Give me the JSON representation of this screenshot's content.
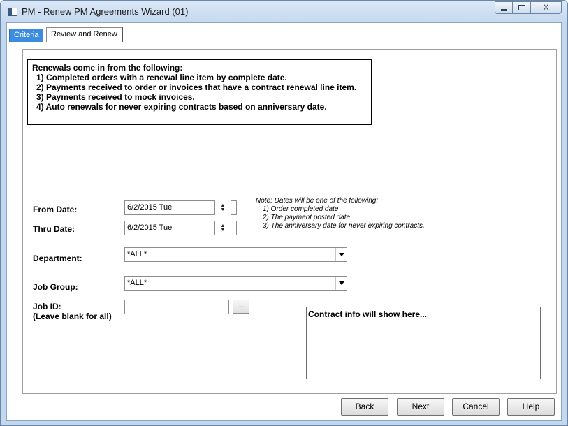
{
  "window": {
    "title": "PM - Renew PM Agreements Wizard (01)",
    "controls": {
      "minimize": "minimize-icon",
      "maximize": "maximize-icon",
      "close": "close-icon",
      "close_glyph": "X"
    }
  },
  "tabs": [
    {
      "label": "Criteria",
      "active": true
    },
    {
      "label": "Review and Renew",
      "active": false
    }
  ],
  "info": {
    "heading": "Renewals come in from the following:",
    "items": [
      "1) Completed orders with a renewal line item by complete date.",
      "2) Payments received to order or invoices that have a contract renewal line item.",
      "3) Payments received to mock invoices.",
      "4) Auto renewals for never expiring contracts based on anniversary date."
    ]
  },
  "form": {
    "from_date": {
      "label": "From Date:",
      "value": "6/2/2015 Tue"
    },
    "thru_date": {
      "label": "Thru Date:",
      "value": "6/2/2015 Tue"
    },
    "department": {
      "label": "Department:",
      "value": "*ALL*"
    },
    "job_group": {
      "label": "Job Group:",
      "value": "*ALL*"
    },
    "job_id": {
      "label": "Job ID:",
      "sublabel": "(Leave blank for all)",
      "value": "",
      "browse_label": "..."
    }
  },
  "note": {
    "heading": "Note: Dates will be one of the following:",
    "items": [
      "1) Order completed date",
      "2) The payment posted date",
      "3) The anniversary date for never expiring contracts."
    ]
  },
  "contract_info": {
    "text": "Contract info will show here..."
  },
  "buttons": {
    "back": "Back",
    "next": "Next",
    "cancel": "Cancel",
    "help": "Help"
  },
  "colors": {
    "active_tab": "#3c8de0",
    "window_frame": "#c3d8ee"
  }
}
